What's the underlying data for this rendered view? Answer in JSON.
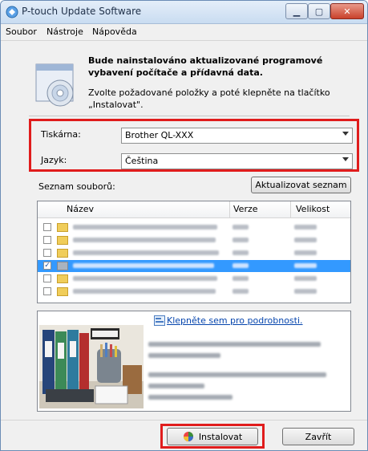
{
  "window": {
    "title": "P-touch Update Software"
  },
  "menu": [
    "Soubor",
    "Nástroje",
    "Nápověda"
  ],
  "header": {
    "bold_text": "Bude nainstalováno aktualizované programové vybavení počítače a přídavná data.",
    "normal_text": "Zvolte požadované položky a poté klepněte na tlačítko „Instalovat\"."
  },
  "settings": {
    "printer_label": "Tiskárna:",
    "printer_value": "Brother QL-XXX",
    "language_label": "Jazyk:",
    "language_value": "Čeština"
  },
  "files": {
    "title": "Seznam souborů:",
    "refresh_button": "Aktualizovat seznam",
    "columns": [
      "Název",
      "Verze",
      "Velikost"
    ],
    "rows": [
      {
        "checked": false,
        "selected": false
      },
      {
        "checked": false,
        "selected": false
      },
      {
        "checked": false,
        "selected": false
      },
      {
        "checked": true,
        "selected": true
      },
      {
        "checked": false,
        "selected": false
      },
      {
        "checked": false,
        "selected": false
      }
    ]
  },
  "info": {
    "link": "Klepněte sem pro podrobnosti."
  },
  "buttons": {
    "install": "Instalovat",
    "close": "Zavřít"
  },
  "colors": {
    "highlight_box": "#e01c1c",
    "selection": "#3399ff"
  }
}
